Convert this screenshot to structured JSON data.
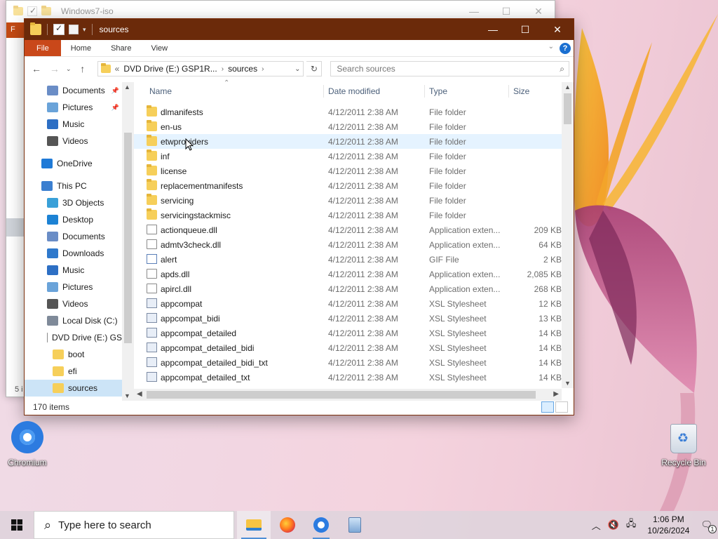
{
  "back_window": {
    "title": "Windows7-iso",
    "ribbon_file_letter": "F",
    "status_text": "5 i"
  },
  "window": {
    "title": "sources",
    "controls": {
      "minimize": "—",
      "maximize": "☐",
      "close": "✕"
    },
    "ribbon_tabs": [
      {
        "label": "File"
      },
      {
        "label": "Home"
      },
      {
        "label": "Share"
      },
      {
        "label": "View"
      }
    ],
    "help_label": "?",
    "address": {
      "prefix": "«",
      "crumbs": [
        "DVD Drive (E:) GSP1R...",
        "sources"
      ]
    },
    "search": {
      "placeholder": "Search sources"
    },
    "nav_pane": [
      {
        "label": "Documents",
        "icon": "documents-icon",
        "pinned": true,
        "indent": 32,
        "color": "#6a8dc6"
      },
      {
        "label": "Pictures",
        "icon": "pictures-icon",
        "pinned": true,
        "indent": 32,
        "color": "#6aa3d9"
      },
      {
        "label": "Music",
        "icon": "music-icon",
        "pinned": false,
        "indent": 32,
        "color": "#2d6fc4"
      },
      {
        "label": "Videos",
        "icon": "videos-icon",
        "pinned": false,
        "indent": 32,
        "color": "#555555"
      },
      {
        "label": "OneDrive",
        "icon": "onedrive-icon",
        "pinned": false,
        "indent": 24,
        "color": "#1f7ad7",
        "gap": true
      },
      {
        "label": "This PC",
        "icon": "this-pc-icon",
        "pinned": false,
        "indent": 24,
        "color": "#3b7fd0",
        "gap": true
      },
      {
        "label": "3D Objects",
        "icon": "3d-objects-icon",
        "pinned": false,
        "indent": 32,
        "color": "#39a0d8"
      },
      {
        "label": "Desktop",
        "icon": "desktop-icon",
        "pinned": false,
        "indent": 32,
        "color": "#1c82d4"
      },
      {
        "label": "Documents",
        "icon": "documents-icon",
        "pinned": false,
        "indent": 32,
        "color": "#6a8dc6"
      },
      {
        "label": "Downloads",
        "icon": "downloads-icon",
        "pinned": false,
        "indent": 32,
        "color": "#2f79cc"
      },
      {
        "label": "Music",
        "icon": "music-icon",
        "pinned": false,
        "indent": 32,
        "color": "#2d6fc4"
      },
      {
        "label": "Pictures",
        "icon": "pictures-icon",
        "pinned": false,
        "indent": 32,
        "color": "#6aa3d9"
      },
      {
        "label": "Videos",
        "icon": "videos-icon",
        "pinned": false,
        "indent": 32,
        "color": "#555555"
      },
      {
        "label": "Local Disk (C:)",
        "icon": "local-disk-icon",
        "pinned": false,
        "indent": 32,
        "color": "#7f8a99"
      },
      {
        "label": "DVD Drive (E:) GS",
        "icon": "dvd-drive-icon",
        "pinned": false,
        "indent": 32,
        "color": "#8a8a8a"
      },
      {
        "label": "boot",
        "icon": "folder-icon",
        "pinned": false,
        "indent": 40,
        "color": "#f6cf5a"
      },
      {
        "label": "efi",
        "icon": "folder-icon",
        "pinned": false,
        "indent": 40,
        "color": "#f6cf5a"
      },
      {
        "label": "sources",
        "icon": "folder-icon",
        "pinned": false,
        "indent": 40,
        "color": "#f6cf5a",
        "selected": true
      }
    ],
    "columns": {
      "name": "Name",
      "date": "Date modified",
      "type": "Type",
      "size": "Size"
    },
    "files": [
      {
        "name": "dlmanifests",
        "date": "4/12/2011 2:38 AM",
        "type": "File folder",
        "size": "",
        "icon": "folder-icon"
      },
      {
        "name": "en-us",
        "date": "4/12/2011 2:38 AM",
        "type": "File folder",
        "size": "",
        "icon": "folder-icon"
      },
      {
        "name": "etwproviders",
        "date": "4/12/2011 2:38 AM",
        "type": "File folder",
        "size": "",
        "icon": "folder-icon",
        "hover": true
      },
      {
        "name": "inf",
        "date": "4/12/2011 2:38 AM",
        "type": "File folder",
        "size": "",
        "icon": "folder-icon"
      },
      {
        "name": "license",
        "date": "4/12/2011 2:38 AM",
        "type": "File folder",
        "size": "",
        "icon": "folder-icon"
      },
      {
        "name": "replacementmanifests",
        "date": "4/12/2011 2:38 AM",
        "type": "File folder",
        "size": "",
        "icon": "folder-icon"
      },
      {
        "name": "servicing",
        "date": "4/12/2011 2:38 AM",
        "type": "File folder",
        "size": "",
        "icon": "folder-icon"
      },
      {
        "name": "servicingstackmisc",
        "date": "4/12/2011 2:38 AM",
        "type": "File folder",
        "size": "",
        "icon": "folder-icon"
      },
      {
        "name": "actionqueue.dll",
        "date": "4/12/2011 2:38 AM",
        "type": "Application exten...",
        "size": "209 KB",
        "icon": "dll-file-icon"
      },
      {
        "name": "admtv3check.dll",
        "date": "4/12/2011 2:38 AM",
        "type": "Application exten...",
        "size": "64 KB",
        "icon": "dll-file-icon"
      },
      {
        "name": "alert",
        "date": "4/12/2011 2:38 AM",
        "type": "GIF File",
        "size": "2 KB",
        "icon": "gif-file-icon"
      },
      {
        "name": "apds.dll",
        "date": "4/12/2011 2:38 AM",
        "type": "Application exten...",
        "size": "2,085 KB",
        "icon": "dll-file-icon"
      },
      {
        "name": "apircl.dll",
        "date": "4/12/2011 2:38 AM",
        "type": "Application exten...",
        "size": "268 KB",
        "icon": "dll-file-icon"
      },
      {
        "name": "appcompat",
        "date": "4/12/2011 2:38 AM",
        "type": "XSL Stylesheet",
        "size": "12 KB",
        "icon": "xsl-file-icon"
      },
      {
        "name": "appcompat_bidi",
        "date": "4/12/2011 2:38 AM",
        "type": "XSL Stylesheet",
        "size": "13 KB",
        "icon": "xsl-file-icon"
      },
      {
        "name": "appcompat_detailed",
        "date": "4/12/2011 2:38 AM",
        "type": "XSL Stylesheet",
        "size": "14 KB",
        "icon": "xsl-file-icon"
      },
      {
        "name": "appcompat_detailed_bidi",
        "date": "4/12/2011 2:38 AM",
        "type": "XSL Stylesheet",
        "size": "14 KB",
        "icon": "xsl-file-icon"
      },
      {
        "name": "appcompat_detailed_bidi_txt",
        "date": "4/12/2011 2:38 AM",
        "type": "XSL Stylesheet",
        "size": "14 KB",
        "icon": "xsl-file-icon"
      },
      {
        "name": "appcompat_detailed_txt",
        "date": "4/12/2011 2:38 AM",
        "type": "XSL Stylesheet",
        "size": "14 KB",
        "icon": "xsl-file-icon"
      }
    ],
    "status": {
      "item_count": "170 items"
    }
  },
  "desktop": {
    "icons": [
      {
        "label": "Chromium",
        "icon": "chromium-icon"
      },
      {
        "label": "Recycle Bin",
        "icon": "recycle-bin-icon"
      }
    ]
  },
  "taskbar": {
    "search_placeholder": "Type here to search",
    "apps": [
      {
        "name": "file-explorer",
        "icon": "file-explorer-icon",
        "active": true
      },
      {
        "name": "firefox",
        "icon": "firefox-icon",
        "active": false
      },
      {
        "name": "chromium",
        "icon": "chromium-icon",
        "active": false,
        "open": true
      },
      {
        "name": "installer",
        "icon": "installer-icon",
        "active": false
      }
    ],
    "clock": {
      "time": "1:06 PM",
      "date": "10/26/2024"
    },
    "notification_count": "1"
  },
  "colors": {
    "titlebar": "#6b2a0a",
    "file_tab": "#c9481a",
    "selection": "#cce4f7",
    "hover_row": "#e5f3ff",
    "accent_blue": "#1a6fd1"
  }
}
